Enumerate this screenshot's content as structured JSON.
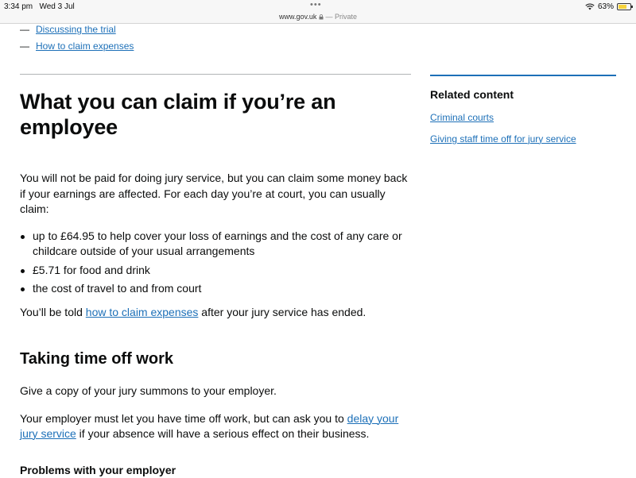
{
  "status_bar": {
    "time": "3:34 pm",
    "date": "Wed 3 Jul",
    "dots": "•••",
    "url": "www.gov.uk",
    "private_label": "— Private",
    "battery": "63%",
    "icons": [
      "lock-icon",
      "wifi-icon",
      "battery-icon"
    ]
  },
  "contents": [
    {
      "dash": "—",
      "label": "Discussing the trial"
    },
    {
      "dash": "—",
      "label": "How to claim expenses"
    }
  ],
  "main": {
    "heading": "What you can claim if you’re an employee",
    "intro": "You will not be paid for doing jury service, but you can claim some money back if your earnings are affected. For each day you’re at court, you can usually claim:",
    "bullets": [
      "up to £64.95 to help cover your loss of earnings and the cost of any care or childcare outside of your usual arrangements",
      "£5.71 for food and drink",
      "the cost of travel to and from court"
    ],
    "told_prefix": "You’ll be told ",
    "told_link": "how to claim expenses",
    "told_suffix": " after your jury service has ended.",
    "time_off_heading": "Taking time off work",
    "summons_text": "Give a copy of your jury summons to your employer.",
    "employer_prefix": "Your employer must let you have time off work, but can ask you to ",
    "employer_link": "delay your jury service",
    "employer_suffix": " if your absence will have a serious effect on their business.",
    "problems_heading": "Problems with your employer"
  },
  "related": {
    "heading": "Related content",
    "links": [
      "Criminal courts",
      "Giving staff time off for jury service"
    ]
  },
  "colors": {
    "link": "#1d70b8",
    "text": "#0b0c0c",
    "rule": "#b1b4b6"
  }
}
